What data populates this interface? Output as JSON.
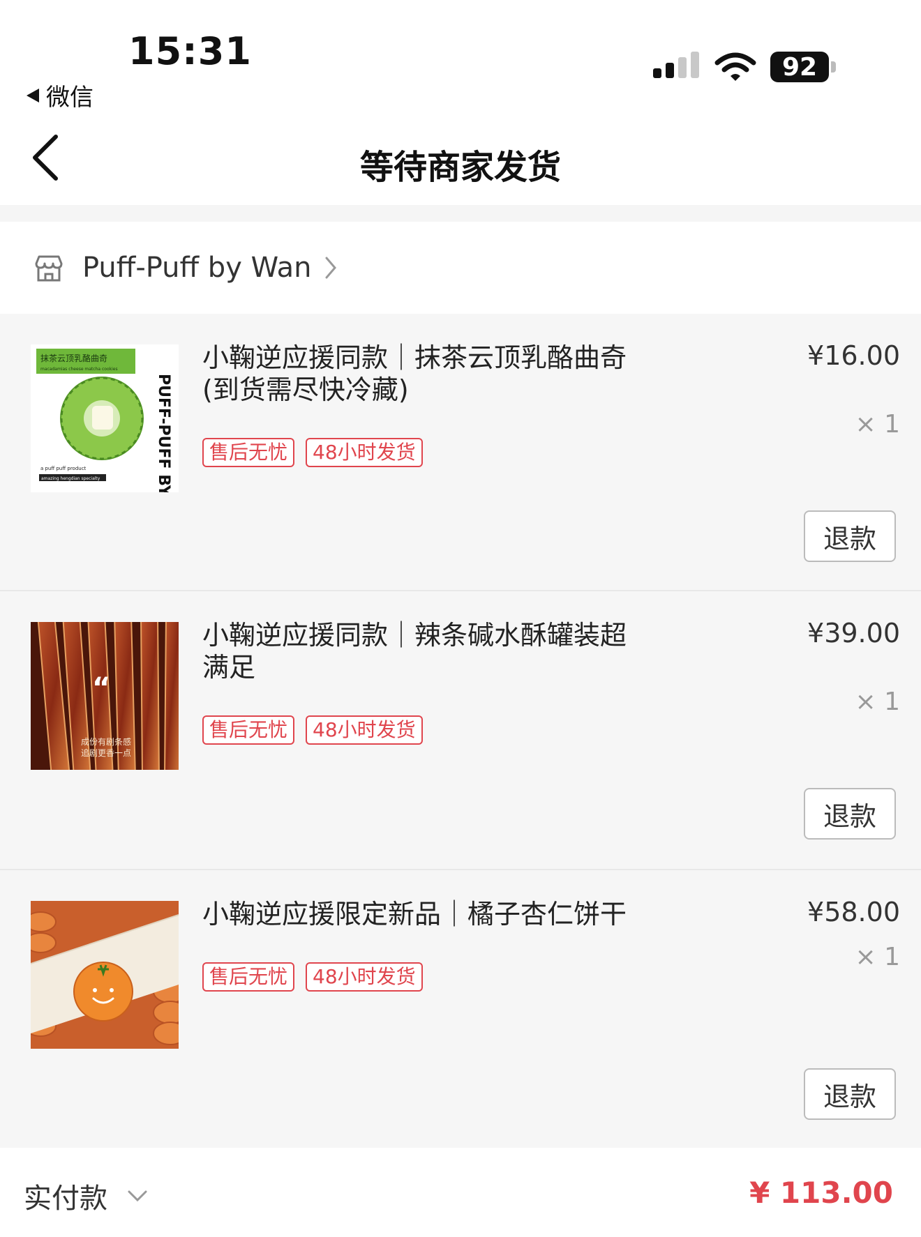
{
  "status_bar": {
    "time": "15:31",
    "back_app": "微信",
    "battery": "92"
  },
  "nav": {
    "title": "等待商家发货"
  },
  "shop": {
    "name": "Puff-Puff by Wan"
  },
  "items": [
    {
      "title": "小鞠逆应援同款｜抹茶云顶乳酪曲奇(到货需尽快冷藏)",
      "price": "¥16.00",
      "qty": "× 1",
      "tags": [
        "售后无忧",
        "48小时发货"
      ],
      "refund": "退款",
      "thumb": {
        "banner": "抹茶云顶乳酪曲奇",
        "banner_sub": "macadamias cheese matcha cookies",
        "brand": "PUFF-PUFF BY WAN",
        "foot1": "a puff puff product",
        "foot2": "amazing hengdian specialty"
      }
    },
    {
      "title": "小鞠逆应援同款｜辣条碱水酥罐装超满足",
      "price": "¥39.00",
      "qty": "× 1",
      "tags": [
        "售后无忧",
        "48小时发货"
      ],
      "refund": "退款",
      "thumb": {
        "overlay1": "成份有剧条感",
        "overlay2": "追剧更香一点"
      }
    },
    {
      "title": "小鞠逆应援限定新品｜橘子杏仁饼干",
      "price": "¥58.00",
      "qty": "× 1",
      "tags": [
        "售后无忧",
        "48小时发货"
      ],
      "refund": "退款"
    }
  ],
  "footer": {
    "label": "实付款",
    "total": "¥ 113.00"
  },
  "colors": {
    "accent": "#e0454d",
    "matcha": "#6fb83a"
  }
}
